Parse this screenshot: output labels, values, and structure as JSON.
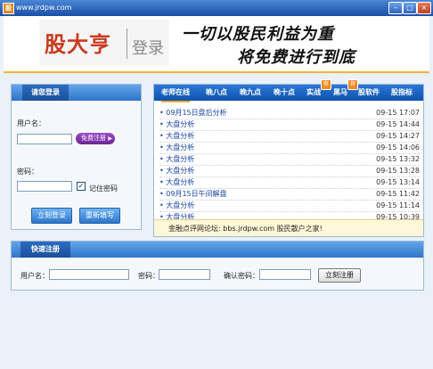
{
  "window": {
    "title": "www.jrdpw.com",
    "icon_text": "股"
  },
  "header": {
    "brand": "股大亨",
    "login_word": "登录",
    "slogan_line1": "一切以股民利益为重",
    "slogan_line2": "将免费进行到底"
  },
  "login": {
    "title": "请您登录",
    "username_label": "用户名：",
    "username_value": "",
    "register_pill": "免费注册",
    "password_label": "密码：",
    "password_value": "",
    "remember_label": "记住密码",
    "remember_checked": "✓",
    "login_button": "立刻登录",
    "reset_button": "重新填写"
  },
  "news": {
    "tabs": [
      "老师在线",
      "晚八点",
      "晚九点",
      "晚十点",
      "实战",
      "黑马",
      "股软件",
      "股指标"
    ],
    "badge_text": "荐",
    "items": [
      {
        "title": "• 09月15日盘后分析",
        "time": "09-15 17:07"
      },
      {
        "title": "• 大盘分析",
        "time": "09-15 14:44"
      },
      {
        "title": "• 大盘分析",
        "time": "09-15 14:27"
      },
      {
        "title": "• 大盘分析",
        "time": "09-15 14:06"
      },
      {
        "title": "• 大盘分析",
        "time": "09-15 13:32"
      },
      {
        "title": "• 大盘分析",
        "time": "09-15 13:28"
      },
      {
        "title": "• 大盘分析",
        "time": "09-15 13:14"
      },
      {
        "title": "• 09月15日午间解盘",
        "time": "09-15 11:42"
      },
      {
        "title": "• 大盘分析",
        "time": "09-15 11:14"
      },
      {
        "title": "• 大盘分析",
        "time": "09-15 10:39"
      }
    ],
    "forum_text": "金融点评网论坛: bbs.jrdpw.com 股民散户之家!"
  },
  "register": {
    "title": "快速注册",
    "username_label": "用户名：",
    "username_value": "",
    "password_label": "密码：",
    "password_value": "",
    "confirm_label": "确认密码：",
    "confirm_value": "",
    "submit_button": "立刻注册"
  },
  "colors": {
    "accent": "#2c78d6",
    "brand_red": "#c83a1e",
    "underline": "#f2b02e"
  }
}
